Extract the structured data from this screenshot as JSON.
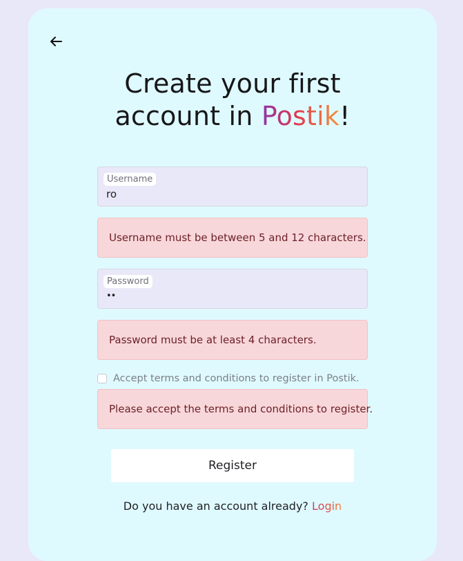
{
  "heading": {
    "line1": "Create your first",
    "line2_prefix": "account in ",
    "brand": "Postik",
    "suffix": "!"
  },
  "form": {
    "username": {
      "label": "Username",
      "value": "ro"
    },
    "username_error": "Username must be between 5 and 12 characters.",
    "password": {
      "label": "Password",
      "value": "••"
    },
    "password_error": "Password must be at least 4 characters.",
    "terms_label": "Accept terms and conditions to register in Postik.",
    "terms_error": "Please accept the terms and conditions to register.",
    "register_label": "Register"
  },
  "footer": {
    "prompt": "Do you have an account already? ",
    "login_label": "Login"
  },
  "icons": {
    "back": "arrow-left-icon"
  },
  "colors": {
    "page_bg": "#e8e8f8",
    "card_bg": "#dffafe",
    "error_bg": "#f8d7da",
    "error_text": "#6b1f27",
    "brand_gradient_start": "#8e35a9",
    "brand_gradient_end": "#f3943f"
  }
}
